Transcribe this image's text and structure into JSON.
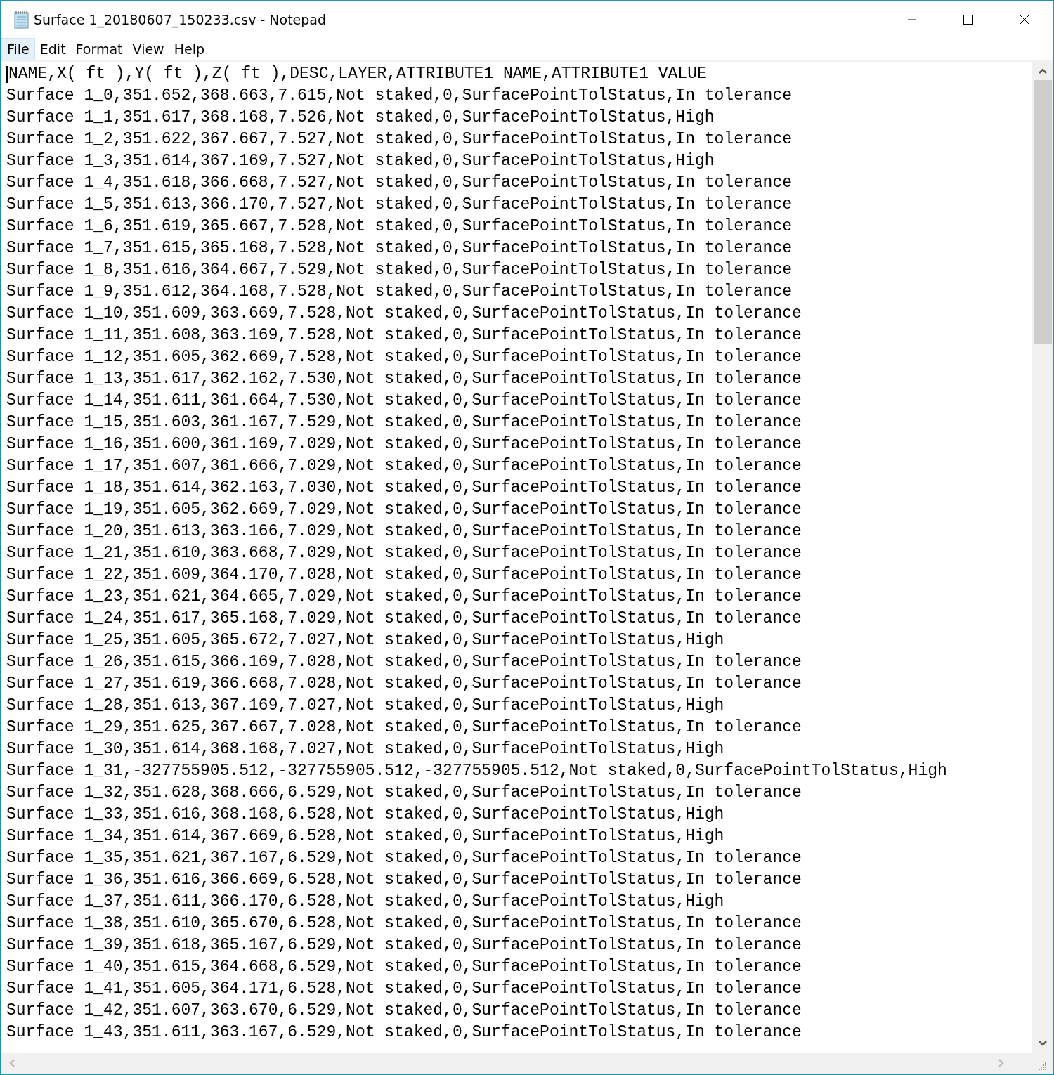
{
  "window": {
    "title": "Surface 1_20180607_150233.csv - Notepad"
  },
  "menu": [
    {
      "label": "File",
      "selected": true
    },
    {
      "label": "Edit",
      "selected": false
    },
    {
      "label": "Format",
      "selected": false
    },
    {
      "label": "View",
      "selected": false
    },
    {
      "label": "Help",
      "selected": false
    }
  ],
  "editor": {
    "lines": [
      "NAME,X( ft ),Y( ft ),Z( ft ),DESC,LAYER,ATTRIBUTE1 NAME,ATTRIBUTE1 VALUE",
      "Surface 1_0,351.652,368.663,7.615,Not staked,0,SurfacePointTolStatus,In tolerance",
      "Surface 1_1,351.617,368.168,7.526,Not staked,0,SurfacePointTolStatus,High",
      "Surface 1_2,351.622,367.667,7.527,Not staked,0,SurfacePointTolStatus,In tolerance",
      "Surface 1_3,351.614,367.169,7.527,Not staked,0,SurfacePointTolStatus,High",
      "Surface 1_4,351.618,366.668,7.527,Not staked,0,SurfacePointTolStatus,In tolerance",
      "Surface 1_5,351.613,366.170,7.527,Not staked,0,SurfacePointTolStatus,In tolerance",
      "Surface 1_6,351.619,365.667,7.528,Not staked,0,SurfacePointTolStatus,In tolerance",
      "Surface 1_7,351.615,365.168,7.528,Not staked,0,SurfacePointTolStatus,In tolerance",
      "Surface 1_8,351.616,364.667,7.529,Not staked,0,SurfacePointTolStatus,In tolerance",
      "Surface 1_9,351.612,364.168,7.528,Not staked,0,SurfacePointTolStatus,In tolerance",
      "Surface 1_10,351.609,363.669,7.528,Not staked,0,SurfacePointTolStatus,In tolerance",
      "Surface 1_11,351.608,363.169,7.528,Not staked,0,SurfacePointTolStatus,In tolerance",
      "Surface 1_12,351.605,362.669,7.528,Not staked,0,SurfacePointTolStatus,In tolerance",
      "Surface 1_13,351.617,362.162,7.530,Not staked,0,SurfacePointTolStatus,In tolerance",
      "Surface 1_14,351.611,361.664,7.530,Not staked,0,SurfacePointTolStatus,In tolerance",
      "Surface 1_15,351.603,361.167,7.529,Not staked,0,SurfacePointTolStatus,In tolerance",
      "Surface 1_16,351.600,361.169,7.029,Not staked,0,SurfacePointTolStatus,In tolerance",
      "Surface 1_17,351.607,361.666,7.029,Not staked,0,SurfacePointTolStatus,In tolerance",
      "Surface 1_18,351.614,362.163,7.030,Not staked,0,SurfacePointTolStatus,In tolerance",
      "Surface 1_19,351.605,362.669,7.029,Not staked,0,SurfacePointTolStatus,In tolerance",
      "Surface 1_20,351.613,363.166,7.029,Not staked,0,SurfacePointTolStatus,In tolerance",
      "Surface 1_21,351.610,363.668,7.029,Not staked,0,SurfacePointTolStatus,In tolerance",
      "Surface 1_22,351.609,364.170,7.028,Not staked,0,SurfacePointTolStatus,In tolerance",
      "Surface 1_23,351.621,364.665,7.029,Not staked,0,SurfacePointTolStatus,In tolerance",
      "Surface 1_24,351.617,365.168,7.029,Not staked,0,SurfacePointTolStatus,In tolerance",
      "Surface 1_25,351.605,365.672,7.027,Not staked,0,SurfacePointTolStatus,High",
      "Surface 1_26,351.615,366.169,7.028,Not staked,0,SurfacePointTolStatus,In tolerance",
      "Surface 1_27,351.619,366.668,7.028,Not staked,0,SurfacePointTolStatus,In tolerance",
      "Surface 1_28,351.613,367.169,7.027,Not staked,0,SurfacePointTolStatus,High",
      "Surface 1_29,351.625,367.667,7.028,Not staked,0,SurfacePointTolStatus,In tolerance",
      "Surface 1_30,351.614,368.168,7.027,Not staked,0,SurfacePointTolStatus,High",
      "Surface 1_31,-327755905.512,-327755905.512,-327755905.512,Not staked,0,SurfacePointTolStatus,High",
      "Surface 1_32,351.628,368.666,6.529,Not staked,0,SurfacePointTolStatus,In tolerance",
      "Surface 1_33,351.616,368.168,6.528,Not staked,0,SurfacePointTolStatus,High",
      "Surface 1_34,351.614,367.669,6.528,Not staked,0,SurfacePointTolStatus,High",
      "Surface 1_35,351.621,367.167,6.529,Not staked,0,SurfacePointTolStatus,In tolerance",
      "Surface 1_36,351.616,366.669,6.528,Not staked,0,SurfacePointTolStatus,In tolerance",
      "Surface 1_37,351.611,366.170,6.528,Not staked,0,SurfacePointTolStatus,High",
      "Surface 1_38,351.610,365.670,6.528,Not staked,0,SurfacePointTolStatus,In tolerance",
      "Surface 1_39,351.618,365.167,6.529,Not staked,0,SurfacePointTolStatus,In tolerance",
      "Surface 1_40,351.615,364.668,6.529,Not staked,0,SurfacePointTolStatus,In tolerance",
      "Surface 1_41,351.605,364.171,6.528,Not staked,0,SurfacePointTolStatus,In tolerance",
      "Surface 1_42,351.607,363.670,6.529,Not staked,0,SurfacePointTolStatus,In tolerance",
      "Surface 1_43,351.611,363.167,6.529,Not staked,0,SurfacePointTolStatus,In tolerance"
    ]
  }
}
